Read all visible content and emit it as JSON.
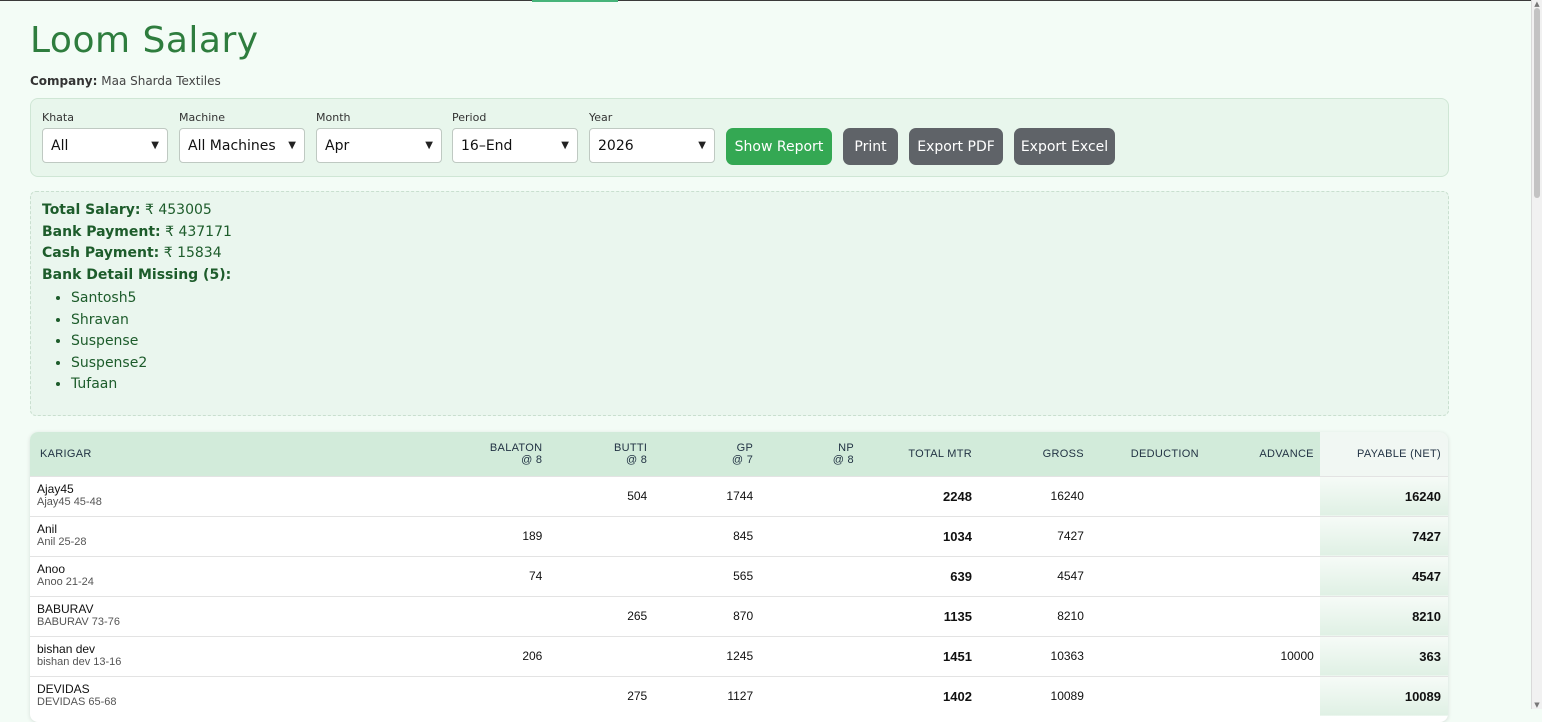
{
  "title": "Loom Salary",
  "company": {
    "label": "Company:",
    "value": "Maa Sharda Textiles"
  },
  "filters": {
    "khata": {
      "label": "Khata",
      "value": "All"
    },
    "machine": {
      "label": "Machine",
      "value": "All Machines"
    },
    "month": {
      "label": "Month",
      "value": "Apr"
    },
    "period": {
      "label": "Period",
      "value": "16–End"
    },
    "year": {
      "label": "Year",
      "value": "2026"
    }
  },
  "buttons": {
    "show_report": "Show Report",
    "print": "Print",
    "export_pdf": "Export PDF",
    "export_excel": "Export Excel"
  },
  "summary": {
    "total_salary": {
      "label": "Total Salary:",
      "value": "₹ 453005"
    },
    "bank_payment": {
      "label": "Bank Payment:",
      "value": "₹ 437171"
    },
    "cash_payment": {
      "label": "Cash Payment:",
      "value": "₹ 15834"
    },
    "missing": {
      "label": "Bank Detail Missing (5):",
      "items": [
        "Santosh5",
        "Shravan",
        "Suspense",
        "Suspense2",
        "Tufaan"
      ]
    }
  },
  "table": {
    "headers": {
      "karigar": "KARIGAR",
      "balaton": "BALATON",
      "balaton_rate": "@ 8",
      "butti": "BUTTI",
      "butti_rate": "@ 8",
      "gp": "GP",
      "gp_rate": "@ 7",
      "np": "NP",
      "np_rate": "@ 8",
      "total_mtr": "TOTAL MTR",
      "gross": "GROSS",
      "deduction": "DEDUCTION",
      "advance": "ADVANCE",
      "payable": "PAYABLE (NET)"
    },
    "rows": [
      {
        "name": "Ajay45",
        "sub": "Ajay45 45-48",
        "balaton": "",
        "butti": "504",
        "gp": "1744",
        "np": "",
        "total": "2248",
        "gross": "16240",
        "deduction": "",
        "advance": "",
        "net": "16240"
      },
      {
        "name": "Anil",
        "sub": "Anil 25-28",
        "balaton": "189",
        "butti": "",
        "gp": "845",
        "np": "",
        "total": "1034",
        "gross": "7427",
        "deduction": "",
        "advance": "",
        "net": "7427"
      },
      {
        "name": "Anoo",
        "sub": "Anoo 21-24",
        "balaton": "74",
        "butti": "",
        "gp": "565",
        "np": "",
        "total": "639",
        "gross": "4547",
        "deduction": "",
        "advance": "",
        "net": "4547"
      },
      {
        "name": "BABURAV",
        "sub": "BABURAV 73-76",
        "balaton": "",
        "butti": "265",
        "gp": "870",
        "np": "",
        "total": "1135",
        "gross": "8210",
        "deduction": "",
        "advance": "",
        "net": "8210"
      },
      {
        "name": "bishan dev",
        "sub": "bishan dev 13-16",
        "balaton": "206",
        "butti": "",
        "gp": "1245",
        "np": "",
        "total": "1451",
        "gross": "10363",
        "deduction": "",
        "advance": "10000",
        "net": "363"
      },
      {
        "name": "DEVIDAS",
        "sub": "DEVIDAS 65-68",
        "balaton": "",
        "butti": "275",
        "gp": "1127",
        "np": "",
        "total": "1402",
        "gross": "10089",
        "deduction": "",
        "advance": "",
        "net": "10089"
      }
    ]
  }
}
